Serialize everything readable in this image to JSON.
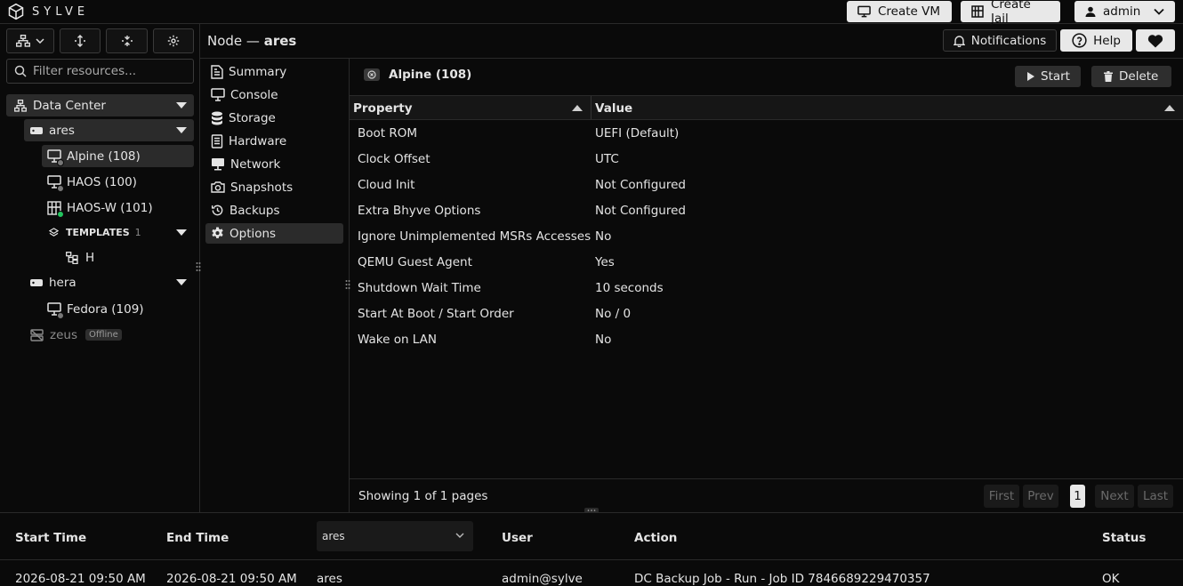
{
  "app": {
    "name": "SYLVE"
  },
  "topbar": {
    "create_vm": "Create VM",
    "create_jail": "Create Jail",
    "user": "admin"
  },
  "sidebar": {
    "filter_placeholder": "Filter resources...",
    "datacenter": "Data Center",
    "nodes": [
      {
        "name": "ares",
        "vms": [
          "Alpine (108)",
          "HAOS (100)",
          "HAOS-W (101)"
        ],
        "templates_label": "TEMPLATES",
        "templates_count": "1",
        "template_item": "H"
      },
      {
        "name": "hera",
        "vms": [
          "Fedora (109)"
        ]
      },
      {
        "name": "zeus",
        "badge": "Offline"
      }
    ]
  },
  "header": {
    "prefix": "Node —",
    "node": "ares",
    "notifications": "Notifications",
    "help": "Help"
  },
  "subnav": [
    "Summary",
    "Console",
    "Storage",
    "Hardware",
    "Network",
    "Snapshots",
    "Backups",
    "Options"
  ],
  "content": {
    "tab_title": "Alpine (108)",
    "start": "Start",
    "delete": "Delete",
    "columns": [
      "Property",
      "Value"
    ],
    "rows": [
      [
        "Boot ROM",
        "UEFI (Default)"
      ],
      [
        "Clock Offset",
        "UTC"
      ],
      [
        "Cloud Init",
        "Not Configured"
      ],
      [
        "Extra Bhyve Options",
        "Not Configured"
      ],
      [
        "Ignore Unimplemented MSRs Accesses",
        "No"
      ],
      [
        "QEMU Guest Agent",
        "Yes"
      ],
      [
        "Shutdown Wait Time",
        "10 seconds"
      ],
      [
        "Start At Boot / Start Order",
        "No / 0"
      ],
      [
        "Wake on LAN",
        "No"
      ]
    ],
    "footer_text": "Showing 1 of 1 pages",
    "pager": {
      "first": "First",
      "prev": "Prev",
      "current": "1",
      "next": "Next",
      "last": "Last"
    }
  },
  "log": {
    "columns": [
      "Start Time",
      "End Time",
      "User",
      "Action",
      "Status"
    ],
    "filter_value": "ares",
    "row": [
      "2026-08-21 09:50 AM",
      "2026-08-21 09:50 AM",
      "ares",
      "admin@sylve",
      "DC Backup Job - Run - Job ID 7846689229470357",
      "OK"
    ]
  }
}
